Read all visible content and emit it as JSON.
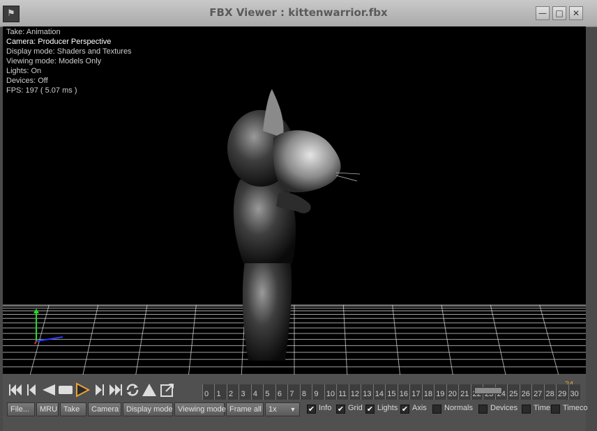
{
  "window": {
    "title": "FBX Viewer : kittenwarrior.fbx",
    "app_icon": "fbx-app-icon",
    "controls": [
      "minimize-icon",
      "maximize-icon",
      "close-icon"
    ]
  },
  "info": {
    "take": "Take: Animation",
    "camera": "Camera: Producer Perspective",
    "display_mode": "Display mode: Shaders and Textures",
    "viewing_mode": "Viewing mode: Models Only",
    "lights": "Lights: On",
    "devices": "Devices: Off",
    "fps": "FPS: 197 ( 5.07 ms )"
  },
  "playback": {
    "icons": [
      "skip-to-start-icon",
      "step-back-icon",
      "play-reverse-icon",
      "stop-icon",
      "play-icon",
      "step-forward-icon",
      "skip-to-end-icon",
      "loop-icon",
      "eject-icon",
      "export-icon"
    ]
  },
  "timeline": {
    "ticks": [
      "0",
      "1",
      "2",
      "3",
      "4",
      "5",
      "6",
      "7",
      "8",
      "9",
      "10",
      "11",
      "12",
      "13",
      "14",
      "15",
      "16",
      "17",
      "18",
      "19",
      "20",
      "21",
      "22",
      "23",
      "24",
      "25",
      "26",
      "27",
      "28",
      "29",
      "30"
    ],
    "current_frame": "24"
  },
  "toolbar": {
    "file": "File...",
    "mru": "MRU",
    "take": "Take",
    "camera": "Camera",
    "display_mode": "Display mode",
    "viewing_mode": "Viewing mode",
    "frame_all": "Frame all",
    "speed": "1x"
  },
  "toggles": [
    {
      "label": "Info",
      "checked": true
    },
    {
      "label": "Grid",
      "checked": true
    },
    {
      "label": "Lights",
      "checked": true
    },
    {
      "label": "Axis",
      "checked": true
    },
    {
      "label": "Normals",
      "checked": false
    },
    {
      "label": "Devices",
      "checked": false
    },
    {
      "label": "Time",
      "checked": false
    },
    {
      "label": "Timeco",
      "checked": false
    }
  ],
  "colors": {
    "viewport_bg": "#000000",
    "grid": "#d9d9d9",
    "axis_x": "#2a3cff",
    "axis_y": "#22dd22",
    "axis_z": "#ff2222",
    "play_accent": "#e8a33a"
  }
}
